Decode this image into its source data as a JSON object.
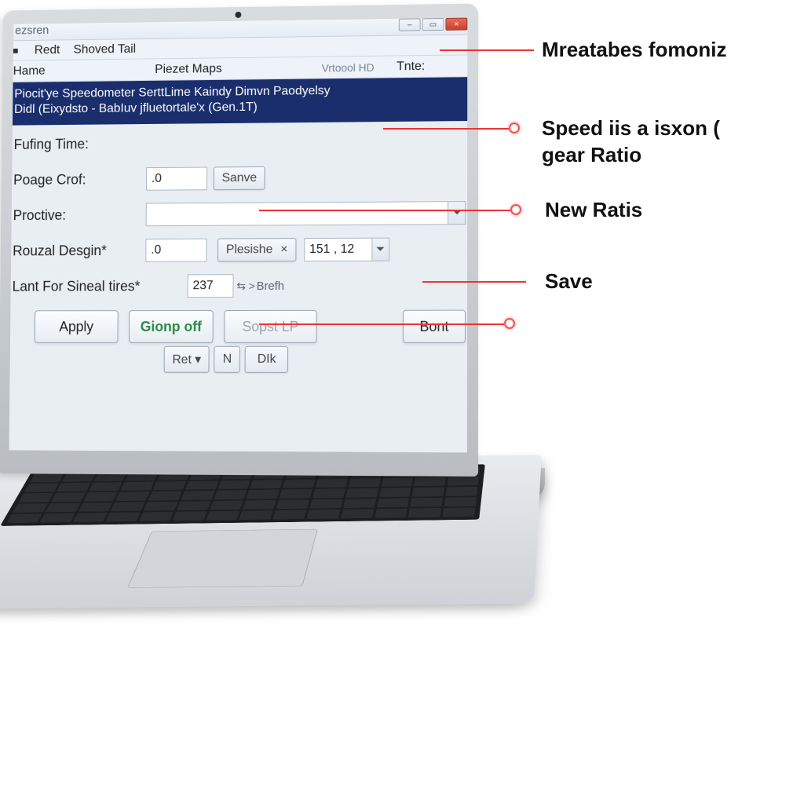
{
  "window": {
    "title": "ezsren",
    "menu": {
      "item1": "Redt",
      "item2": "Shoved Tail"
    }
  },
  "headers": {
    "col1": "Hame",
    "col2": "Piezet Maps",
    "col3": "Vrtoool HD",
    "col4": "Tnte:"
  },
  "selected": {
    "line1": "Piocit'ye Speedometer SerttLime Kaindy Dimvn Paodyelsy",
    "line2": "Didl (Eixydsto - BabIuv jfluetortale'x (Gen.1T)"
  },
  "form": {
    "fufing_label": "Fufing Time:",
    "poage_label": "Poage Crof:",
    "poage_value": ".0",
    "save_small_label": "Sanve",
    "proctive_label": "Proctive:",
    "proctive_value": "",
    "rouzal_label": "Rouzal Desgin*",
    "rouzal_value": ".0",
    "plesishe_label": "Plesishe",
    "plesishe_close": "×",
    "plesishe_combo_value": "151 , 12",
    "lant_label": "Lant For Sineal tires*",
    "lant_value": "237",
    "lant_arrow": "⇆ >",
    "lant_suffix": "Brefh"
  },
  "buttons": {
    "apply": "Apply",
    "gionp": "Gionp off",
    "sopst": "Sopst LP",
    "bont": "Bont",
    "ret": "Ret ▾",
    "n": "N",
    "dik": "DIk"
  },
  "callouts": {
    "c1": "Mreatabes fomoniz",
    "c2a": "Speed iis a isxon (",
    "c2b": "gear Ratio",
    "c3": "New Ratis",
    "c4": "Save"
  }
}
